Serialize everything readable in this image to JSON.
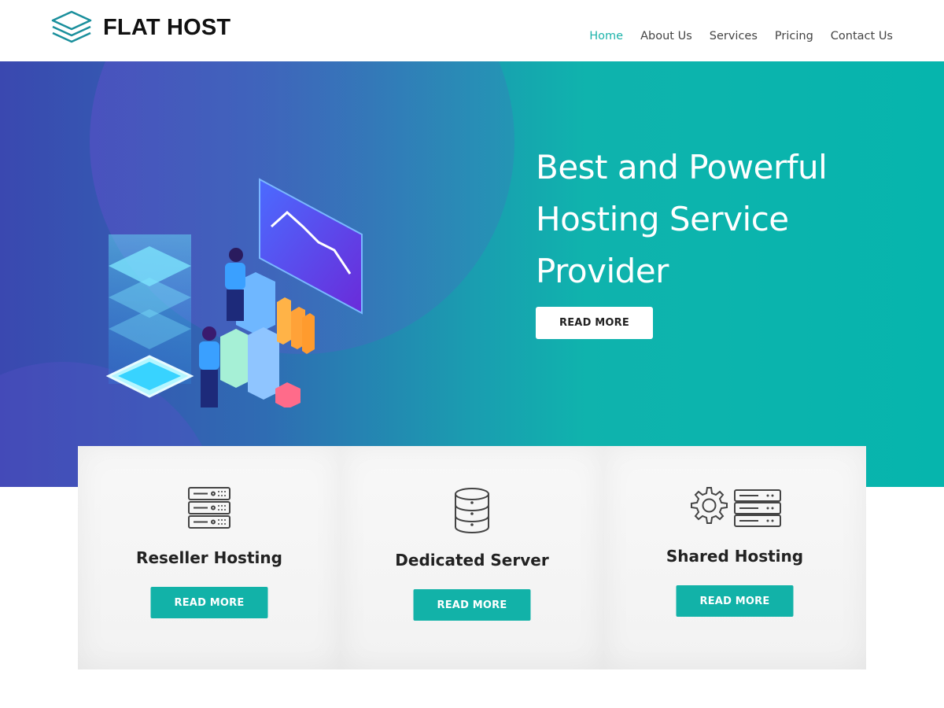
{
  "brand": {
    "name": "FLAT HOST",
    "icon": "stacked-layers-icon",
    "accent_color": "#1cb3aa"
  },
  "nav": {
    "items": [
      {
        "label": "Home",
        "active": true
      },
      {
        "label": "About Us",
        "active": false
      },
      {
        "label": "Services",
        "active": false
      },
      {
        "label": "Pricing",
        "active": false
      },
      {
        "label": "Contact Us",
        "active": false
      }
    ]
  },
  "hero": {
    "title": "Best and Powerful Hosting Service Provider",
    "button_label": "READ MORE",
    "illustration": "isometric-hosting-illustration"
  },
  "services": [
    {
      "title": "Reseller Hosting",
      "button_label": "READ MORE",
      "icon": "server-rack-icon"
    },
    {
      "title": "Dedicated Server",
      "button_label": "READ MORE",
      "icon": "database-icon"
    },
    {
      "title": "Shared Hosting",
      "button_label": "READ MORE",
      "icon": "gear-server-icon"
    }
  ],
  "colors": {
    "button_teal": "#12b2a8",
    "hero_gradient_start": "#3a48b0",
    "hero_gradient_end": "#06b5ad"
  }
}
